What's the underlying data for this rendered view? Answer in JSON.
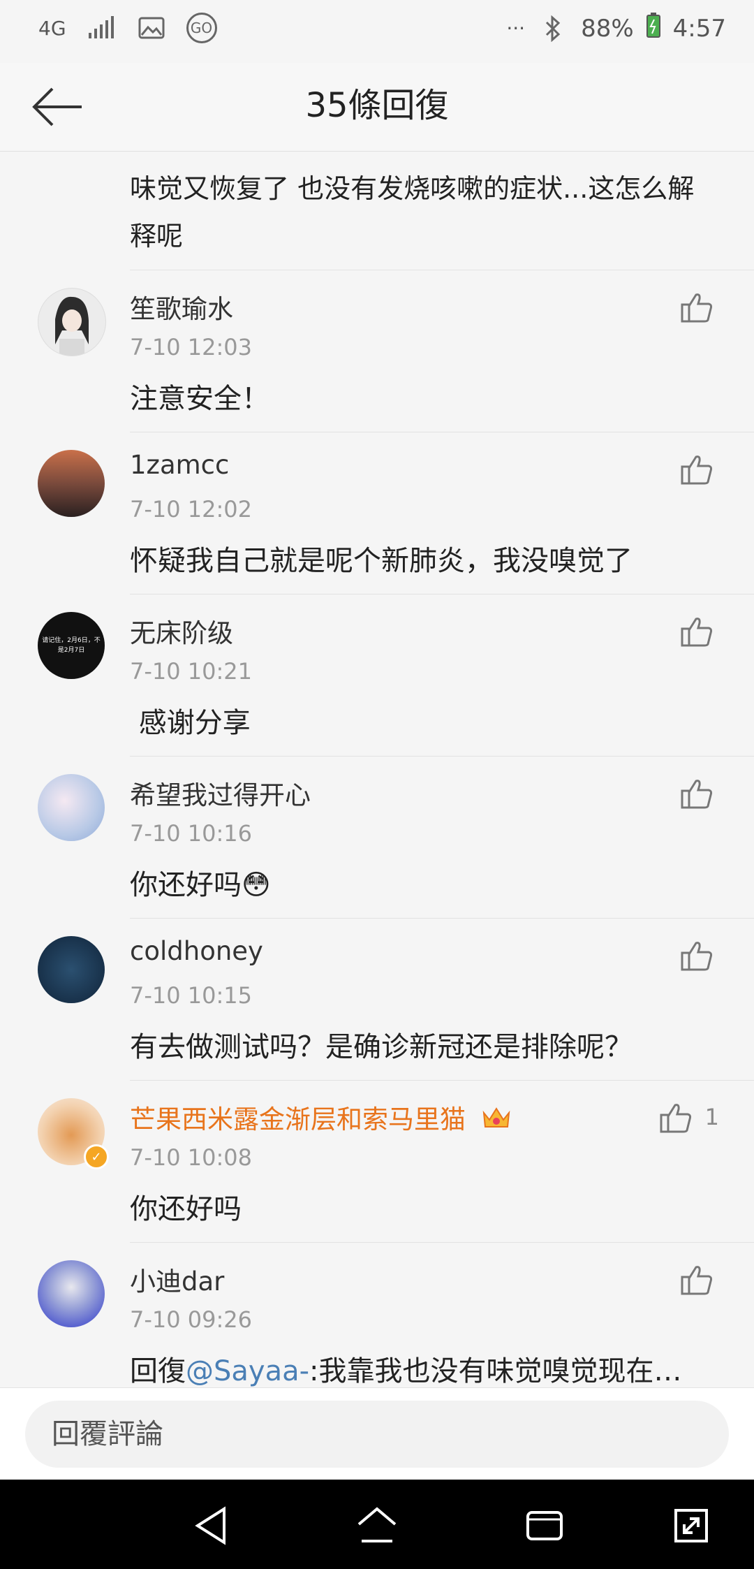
{
  "status_bar": {
    "network": "4G",
    "signal_icon": "signal-icon",
    "image_icon": "image-icon",
    "go_label": "GO",
    "more": "···",
    "bluetooth_icon": "bluetooth-icon",
    "battery_pct": "88%",
    "time": "4:57"
  },
  "header": {
    "back_icon": "back-arrow-icon",
    "title": "35條回復"
  },
  "partial_comment": {
    "text": "味觉又恢复了 也没有发烧咳嗽的症状...这怎么解释呢"
  },
  "comments": [
    {
      "name": "笙歌瑜水",
      "time": "7-10 12:03",
      "text": "注意安全！",
      "avatar_color": "#e9e9e9"
    },
    {
      "name": "1zamcc",
      "time": "7-10 12:02",
      "text": "怀疑我自己就是呢个新肺炎，我没嗅觉了",
      "avatar_color": "#5a3e35"
    },
    {
      "name": "无床阶级",
      "time": "7-10 10:21",
      "text": " 感谢分享",
      "avatar_text": "请记住，2月6日，不是2月7日",
      "avatar_color": "#111111"
    },
    {
      "name": "希望我过得开心",
      "time": "7-10 10:16",
      "text": "你还好吗😳",
      "avatar_color": "#c9d6ec"
    },
    {
      "name": "coldhoney",
      "time": "7-10 10:15",
      "text": "有去做测试吗？是确诊新冠还是排除呢？",
      "avatar_color": "#1d3650"
    },
    {
      "name": "芒果西米露金渐层和索马里猫",
      "time": "7-10 10:08",
      "text": "你还好吗",
      "like_count": "1",
      "vip": true,
      "avatar_color": "#e8b07a"
    },
    {
      "name": "小迪dar",
      "time": "7-10 09:26",
      "text_prefix": "回復",
      "mention": "@Sayaa-",
      "text_suffix": ":我靠我也没有味觉嗅觉现在…",
      "avatar_color": "#3a4bd0"
    }
  ],
  "reply_bar": {
    "placeholder": "回覆評論"
  },
  "nav_bar": {
    "back_icon": "nav-back-icon",
    "home_icon": "nav-home-icon",
    "recents_icon": "nav-recents-icon",
    "expand_icon": "nav-expand-icon"
  }
}
